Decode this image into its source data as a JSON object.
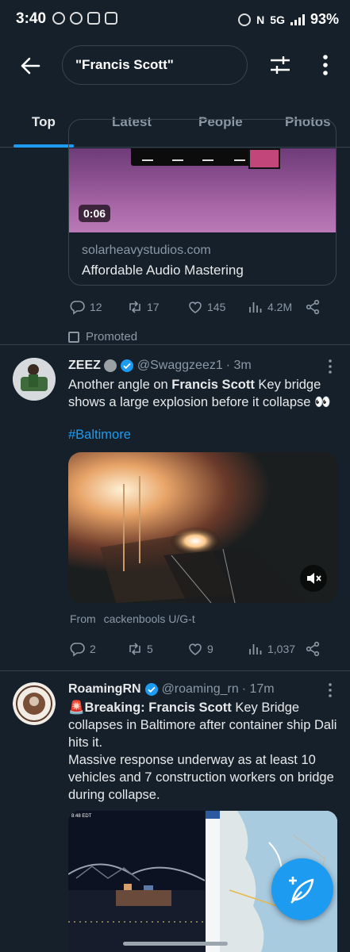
{
  "status_bar": {
    "time": "3:40",
    "network": "5G",
    "battery": "93%"
  },
  "search": {
    "query": "\"Francis Scott\""
  },
  "tabs": [
    {
      "label": "Top",
      "active": true
    },
    {
      "label": "Latest",
      "active": false
    },
    {
      "label": "People",
      "active": false
    },
    {
      "label": "Photos",
      "active": false
    }
  ],
  "ad": {
    "video_duration": "0:06",
    "domain": "solarheavystudios.com",
    "title": "Affordable Audio Mastering",
    "replies": "12",
    "reposts": "17",
    "likes": "145",
    "views": "4.2M",
    "promoted_label": "Promoted"
  },
  "tweet1": {
    "display_name": "ZEEZ",
    "handle": "@Swaggzeez1",
    "time": "· 3m",
    "text_before": "Another angle on ",
    "text_bold": "Francis Scott",
    "text_after": " Key bridge shows a large explosion before it collapse 👀",
    "hashtag": "#Baltimore",
    "from_label": "From",
    "from_source": "cackenbools U/G-t",
    "replies": "2",
    "reposts": "5",
    "likes": "9",
    "views": "1,037"
  },
  "tweet2": {
    "display_name": "RoamingRN",
    "handle": "@roaming_rn",
    "time": "· 17m",
    "text_emoji": "🚨",
    "text_bold1": "Breaking: ",
    "text_bold2": "Francis Scott",
    "text_rest": " Key Bridge collapses in Baltimore after container ship Dali hits it.",
    "text_line2": "Massive response underway as at least 10 vehicles and 7 construction workers on bridge during collapse.",
    "image_timestamp": "8:48 EDT"
  },
  "colors": {
    "accent": "#1d9bf0",
    "background": "#15202b",
    "muted": "#8b98a5",
    "border": "#38444d"
  },
  "icons": [
    "back-arrow-icon",
    "filter-icon",
    "more-vertical-icon",
    "reply-icon",
    "repost-icon",
    "like-icon",
    "views-icon",
    "share-icon",
    "promoted-icon",
    "verified-icon",
    "mute-icon",
    "compose-icon"
  ]
}
